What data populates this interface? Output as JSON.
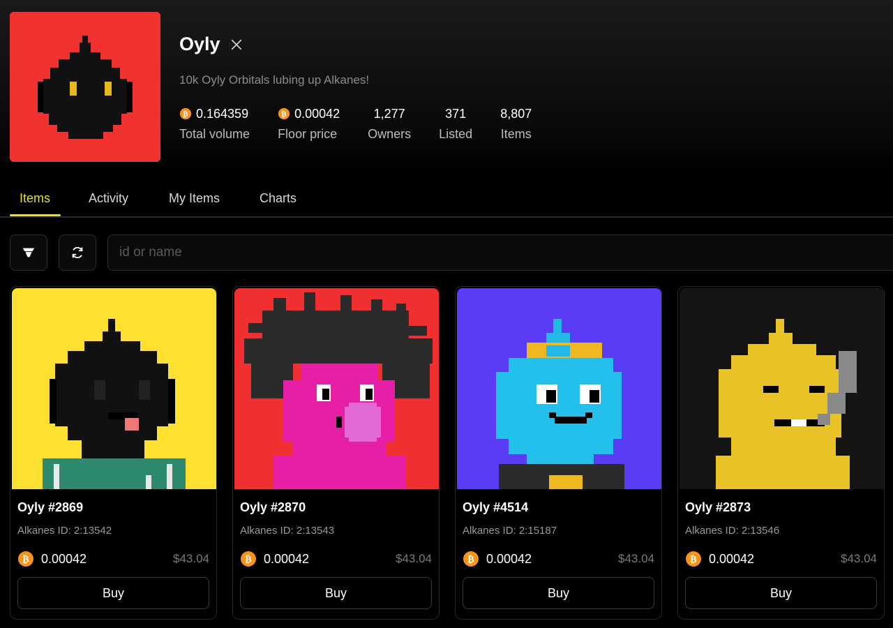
{
  "collection": {
    "name": "Oyly",
    "description": "10k Oyly Orbitals lubing up Alkanes!",
    "social_icon": "x-icon",
    "logo_bg": "#f23131"
  },
  "stats": [
    {
      "value": "0.164359",
      "label": "Total volume",
      "icon": "btc-icon"
    },
    {
      "value": "0.00042",
      "label": "Floor price",
      "icon": "btc-icon"
    },
    {
      "value": "1,277",
      "label": "Owners"
    },
    {
      "value": "371",
      "label": "Listed"
    },
    {
      "value": "8,807",
      "label": "Items"
    }
  ],
  "tabs": [
    {
      "label": "Items",
      "active": true
    },
    {
      "label": "Activity"
    },
    {
      "label": "My Items"
    },
    {
      "label": "Charts"
    }
  ],
  "toolbar": {
    "filter_icon": "filter-icon",
    "refresh_icon": "refresh-icon",
    "search_placeholder": "id or name"
  },
  "cards": [
    {
      "name": "Oyly #2869",
      "id": "Alkanes ID: 2:13542",
      "price": "0.00042",
      "usd": "$43.04",
      "buy": "Buy",
      "bg": "#fde030"
    },
    {
      "name": "Oyly #2870",
      "id": "Alkanes ID: 2:13543",
      "price": "0.00042",
      "usd": "$43.04",
      "buy": "Buy",
      "bg": "#f03030"
    },
    {
      "name": "Oyly #4514",
      "id": "Alkanes ID: 2:15187",
      "price": "0.00042",
      "usd": "$43.04",
      "buy": "Buy",
      "bg": "#5a3cf5"
    },
    {
      "name": "Oyly #2873",
      "id": "Alkanes ID: 2:13546",
      "price": "0.00042",
      "usd": "$43.04",
      "buy": "Buy",
      "bg": "#141414"
    }
  ],
  "colors": {
    "accent": "#e7e02a",
    "btc": "#f7931a"
  }
}
